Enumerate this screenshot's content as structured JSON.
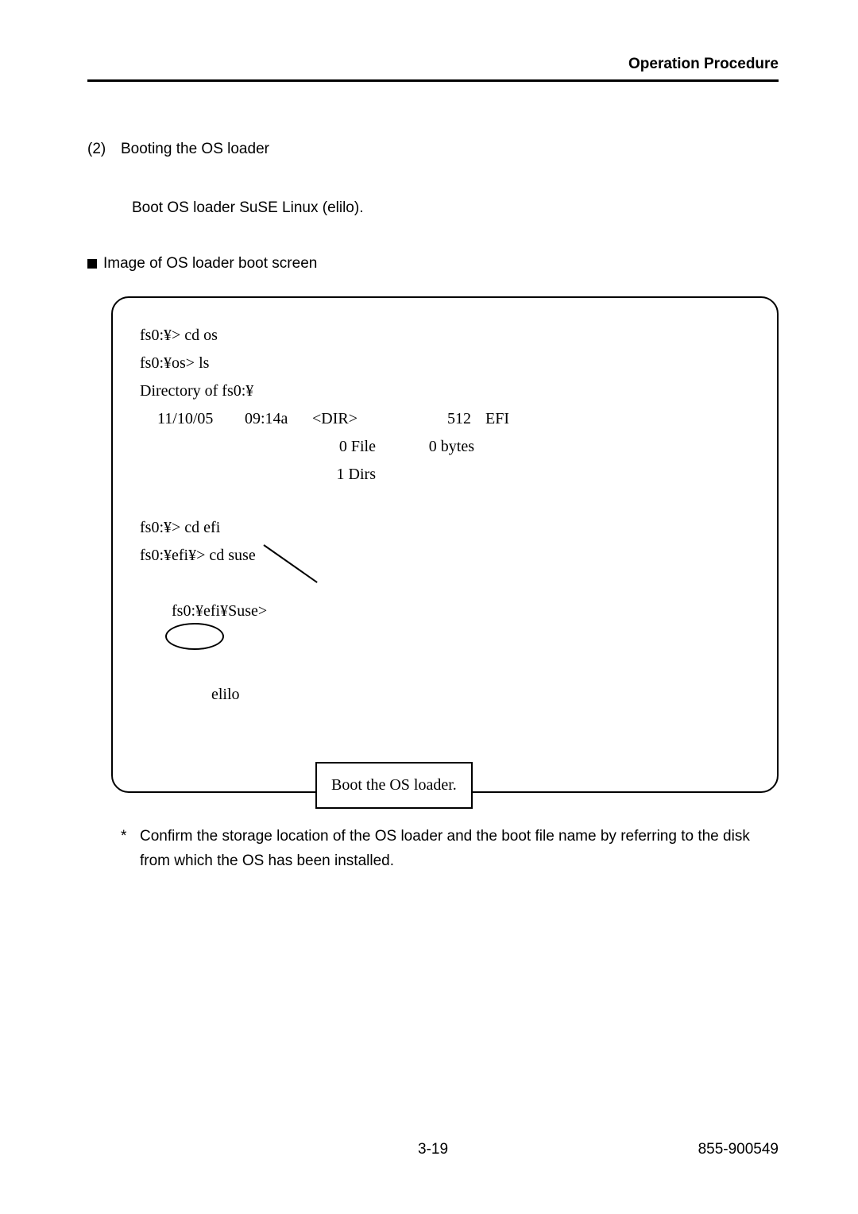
{
  "header": {
    "title": "Operation Procedure"
  },
  "step": {
    "number": "(2)",
    "title": "Booting the OS loader",
    "body": "Boot OS loader SuSE Linux (elilo)."
  },
  "bullet": {
    "text": "Image of OS loader boot screen"
  },
  "terminal": {
    "l1": "fs0:¥> cd os",
    "l2": "fs0:¥os> ls",
    "l3": "Directory of fs0:¥",
    "row": {
      "date": "11/10/05",
      "time": "09:14a",
      "type": "<DIR>",
      "size": "512",
      "name": "EFI"
    },
    "sum1": {
      "type": "0 File",
      "size": "0 bytes"
    },
    "sum2": {
      "type": "1 Dirs"
    },
    "l4": "fs0:¥> cd efi",
    "l5": "fs0:¥efi¥> cd suse",
    "l6_prefix": "fs0:¥efi¥Suse>",
    "l6_circled": "elilo"
  },
  "callout": {
    "text": "Boot the OS loader."
  },
  "note": {
    "star": "*",
    "text": "Confirm the storage location of the OS loader and the boot file name by referring to the disk from which the OS has been installed."
  },
  "footer": {
    "page": "3-19",
    "docnum": "855-900549"
  }
}
